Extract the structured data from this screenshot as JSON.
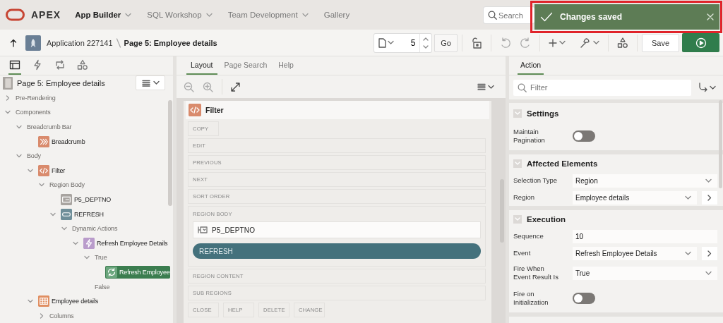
{
  "header": {
    "logo_text": "APEX",
    "nav": [
      {
        "label": "App Builder",
        "selected": true,
        "has_menu": true
      },
      {
        "label": "SQL Workshop",
        "selected": false,
        "has_menu": true
      },
      {
        "label": "Team Development",
        "selected": false,
        "has_menu": true
      },
      {
        "label": "Gallery",
        "selected": false,
        "has_menu": false
      }
    ],
    "search": {
      "placeholder": "Search"
    },
    "toast": {
      "message": "Changes saved"
    }
  },
  "toolbar": {
    "breadcrumb": [
      {
        "label": "Application 227141",
        "current": false
      },
      {
        "label": "Page 5: Employee details",
        "current": true
      }
    ],
    "page_number": "5",
    "go": "Go",
    "save": "Save"
  },
  "left_panel": {
    "tabs": [
      {
        "kind": "rendering",
        "selected": true
      },
      {
        "kind": "dynamic-actions",
        "selected": false
      },
      {
        "kind": "processing",
        "selected": false
      },
      {
        "kind": "shared",
        "selected": false
      }
    ],
    "page_title": "Page 5: Employee details",
    "tree": [
      {
        "label": "Pre-Rendering",
        "kind": "folder",
        "expanded": false,
        "selected": false
      },
      {
        "label": "Components",
        "kind": "folder",
        "expanded": true,
        "selected": false,
        "children": [
          {
            "label": "Breadcrumb Bar",
            "kind": "folder",
            "expanded": true,
            "selected": false,
            "children": [
              {
                "label": "Breadcrumb",
                "kind": "breadcrumb",
                "selected": false
              }
            ]
          },
          {
            "label": "Body",
            "kind": "folder",
            "expanded": true,
            "selected": false,
            "children": [
              {
                "label": "Filter",
                "kind": "region",
                "expanded": true,
                "selected": false,
                "children": [
                  {
                    "label": "Region Body",
                    "kind": "folder",
                    "expanded": true,
                    "selected": false,
                    "children": [
                      {
                        "label": "P5_DEPTNO",
                        "kind": "item",
                        "selected": false
                      },
                      {
                        "label": "REFRESH",
                        "kind": "button",
                        "expanded": true,
                        "selected": false,
                        "children": [
                          {
                            "label": "Dynamic Actions",
                            "kind": "folder",
                            "expanded": true,
                            "selected": false,
                            "children": [
                              {
                                "label": "Refresh Employee Details",
                                "kind": "dynamic-action",
                                "expanded": true,
                                "selected": false,
                                "children": [
                                  {
                                    "label": "True",
                                    "kind": "folder",
                                    "expanded": true,
                                    "selected": false,
                                    "children": [
                                      {
                                        "label": "Refresh Employee",
                                        "kind": "action",
                                        "selected": true
                                      }
                                    ]
                                  },
                                  {
                                    "label": "False",
                                    "kind": "folder",
                                    "selected": false
                                  }
                                ]
                              }
                            ]
                          }
                        ]
                      }
                    ]
                  }
                ]
              },
              {
                "label": "Employee details",
                "kind": "report",
                "expanded": true,
                "selected": false,
                "children": [
                  {
                    "label": "Columns",
                    "kind": "folder",
                    "expanded": false,
                    "selected": false
                  }
                ]
              }
            ]
          }
        ]
      }
    ]
  },
  "layout_panel": {
    "tabs": [
      {
        "label": "Layout",
        "selected": true
      },
      {
        "label": "Page Search",
        "selected": false
      },
      {
        "label": "Help",
        "selected": false
      }
    ],
    "region": {
      "title": "Filter",
      "rows": [
        [
          {
            "label": "COPY",
            "kind": "small"
          }
        ],
        [
          {
            "label": "EDIT",
            "kind": "wide"
          }
        ],
        [
          {
            "label": "PREVIOUS",
            "kind": "wide"
          }
        ],
        [
          {
            "label": "NEXT",
            "kind": "wide"
          }
        ],
        [
          {
            "label": "SORT ORDER",
            "kind": "wide"
          }
        ],
        [
          {
            "label": "REGION BODY",
            "kind": "wide",
            "components": [
              {
                "kind": "item",
                "label": "P5_DEPTNO"
              },
              {
                "kind": "button",
                "label": "REFRESH"
              }
            ]
          }
        ],
        [
          {
            "label": "REGION CONTENT",
            "kind": "wide"
          }
        ],
        [
          {
            "label": "SUB REGIONS",
            "kind": "wide"
          }
        ],
        [
          {
            "label": "CLOSE",
            "kind": "small"
          },
          {
            "label": "HELP",
            "kind": "small"
          },
          {
            "label": "DELETE",
            "kind": "small"
          },
          {
            "label": "CHANGE",
            "kind": "small"
          }
        ]
      ]
    }
  },
  "property_panel": {
    "tabs": [
      {
        "label": "Action",
        "selected": true
      }
    ],
    "filter": {
      "placeholder": "Filter"
    },
    "groups": [
      {
        "title": "Settings",
        "expanded": true,
        "properties": [
          {
            "label": "Maintain Pagination",
            "kind": "switch",
            "on": false
          }
        ]
      },
      {
        "title": "Affected Elements",
        "expanded": true,
        "properties": [
          {
            "label": "Selection Type",
            "kind": "select",
            "value": "Region",
            "link": false
          },
          {
            "label": "Region",
            "kind": "select",
            "value": "Employee details",
            "link": true
          }
        ]
      },
      {
        "title": "Execution",
        "expanded": true,
        "properties": [
          {
            "label": "Sequence",
            "kind": "text",
            "value": "10"
          },
          {
            "label": "Event",
            "kind": "select",
            "value": "Refresh Employee Details",
            "link": true
          },
          {
            "label": "Fire When Event Result Is",
            "kind": "select",
            "value": "True",
            "link": false
          },
          {
            "label": "Fire on Initialization",
            "kind": "switch",
            "on": false
          }
        ]
      }
    ]
  }
}
